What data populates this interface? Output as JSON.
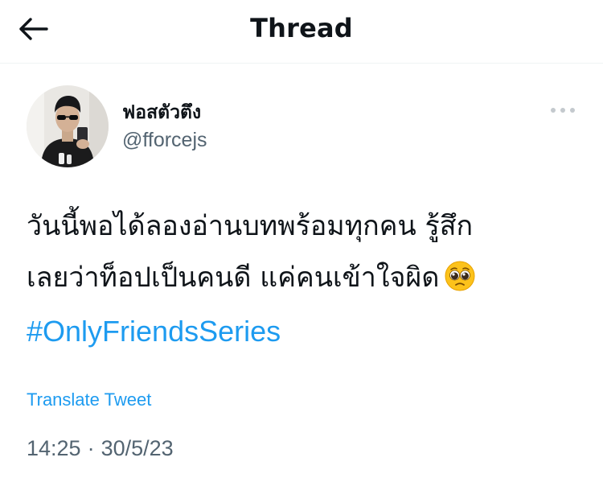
{
  "header": {
    "title": "Thread",
    "back_icon": "arrow-left-icon"
  },
  "tweet": {
    "author": {
      "display_name": "ฟอสตัวตึง",
      "handle": "@fforcejs"
    },
    "more_icon": "more-horizontal-icon",
    "text_lines": [
      "วันนี้พอได้ลองอ่านบทพร้อมทุกคน รู้สึก",
      "เลยว่าท็อปเป็นคนดี แค่คนเข้าใจผิด"
    ],
    "emoji": "pleading-face-emoji",
    "hashtag": "#OnlyFriendsSeries",
    "translate_label": "Translate Tweet",
    "time": "14:25",
    "separator": "·",
    "date": "30/5/23"
  },
  "colors": {
    "accent": "#1d9bf0",
    "text_primary": "#0f1419",
    "text_secondary": "#536471",
    "divider": "#eff3f4"
  }
}
